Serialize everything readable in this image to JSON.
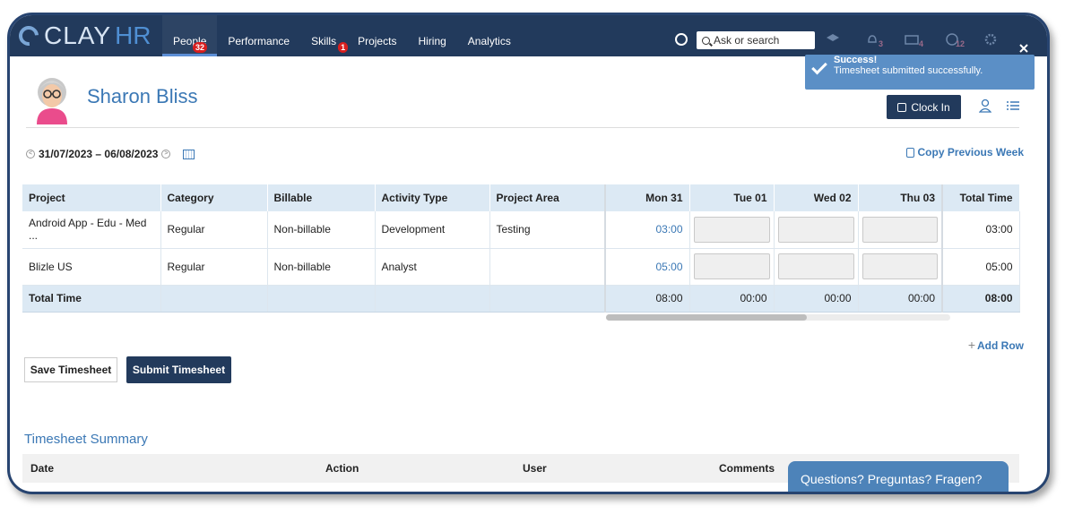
{
  "brand": {
    "name": "CLAY",
    "suffix": "HR"
  },
  "nav": {
    "items": [
      {
        "label": "People",
        "badge": "32"
      },
      {
        "label": "Performance",
        "badge": ""
      },
      {
        "label": "Skills",
        "badge": "1"
      },
      {
        "label": "Projects",
        "badge": ""
      },
      {
        "label": "Hiring",
        "badge": ""
      },
      {
        "label": "Analytics",
        "badge": ""
      }
    ],
    "search_placeholder": "Ask or search",
    "icon_badges": {
      "bell": "3",
      "mail": "4",
      "help": "12"
    }
  },
  "toast": {
    "title": "Success!",
    "message": "Timesheet submitted successfully."
  },
  "header": {
    "name": "Sharon Bliss",
    "clock_in_label": "Clock In"
  },
  "timesheet": {
    "date_range": "31/07/2023 – 06/08/2023",
    "copy_prev_label": "Copy Previous Week",
    "columns": [
      "Project",
      "Category",
      "Billable",
      "Activity Type",
      "Project Area",
      "Mon 31",
      "Tue 01",
      "Wed 02",
      "Thu 03",
      "Total Time"
    ],
    "rows": [
      {
        "project": "Android App - Edu - Med ...",
        "category": "Regular",
        "billable": "Non-billable",
        "activity": "Development",
        "area": "Testing",
        "mon": "03:00",
        "total": "03:00"
      },
      {
        "project": "Blizle US",
        "category": "Regular",
        "billable": "Non-billable",
        "activity": "Analyst",
        "area": "",
        "mon": "05:00",
        "total": "05:00"
      }
    ],
    "totals": {
      "label": "Total Time",
      "mon": "08:00",
      "tue": "00:00",
      "wed": "00:00",
      "thu": "00:00",
      "total": "08:00"
    },
    "add_row_label": "Add Row",
    "save_label": "Save Timesheet",
    "submit_label": "Submit Timesheet"
  },
  "summary": {
    "title": "Timesheet Summary",
    "columns": [
      "Date",
      "Action",
      "User",
      "Comments"
    ]
  },
  "chat_label": "Questions? Preguntas? Fragen?"
}
